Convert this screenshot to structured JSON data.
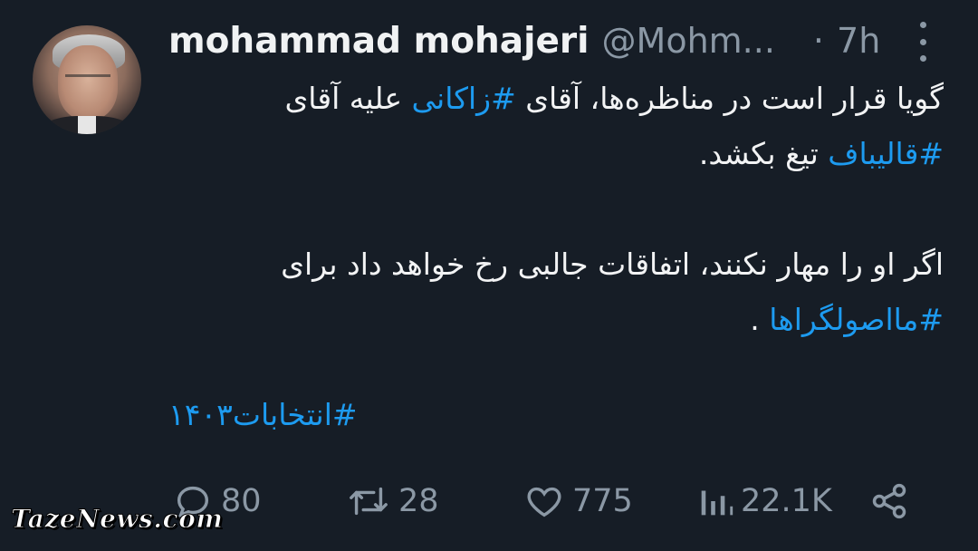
{
  "author": {
    "display_name": "mohammad mohajeri",
    "handle": "@Mohm...",
    "separator": "·",
    "time_ago": "7h"
  },
  "tweet": {
    "line1_prefix": "گویا قرار است در مناظره‌ها، آقای ",
    "line1_tag": "#زاکانی",
    "line1_suffix": " علیه آقای ",
    "line2_tag": "#قالیباف",
    "line2_suffix": " تیغ بکشد.",
    "line3": "اگر او را مهار نکنند، اتفاقات جالبی رخ خواهد داد برای",
    "line4_tag": "#مااصولگراها",
    "line4_suffix": " .",
    "hashtag_footer": "#انتخابات۱۴۰۳"
  },
  "actions": {
    "replies": "80",
    "retweets": "28",
    "likes": "775",
    "views": "22.1K"
  },
  "icons": {
    "reply": "reply-icon",
    "retweet": "retweet-icon",
    "like": "heart-icon",
    "views": "views-icon",
    "share": "share-icon",
    "more": "more-vertical-icon"
  },
  "colors": {
    "background": "#161d26",
    "link": "#1d9bf0",
    "muted": "#8b98a5"
  },
  "watermark": "TazeNews.com"
}
